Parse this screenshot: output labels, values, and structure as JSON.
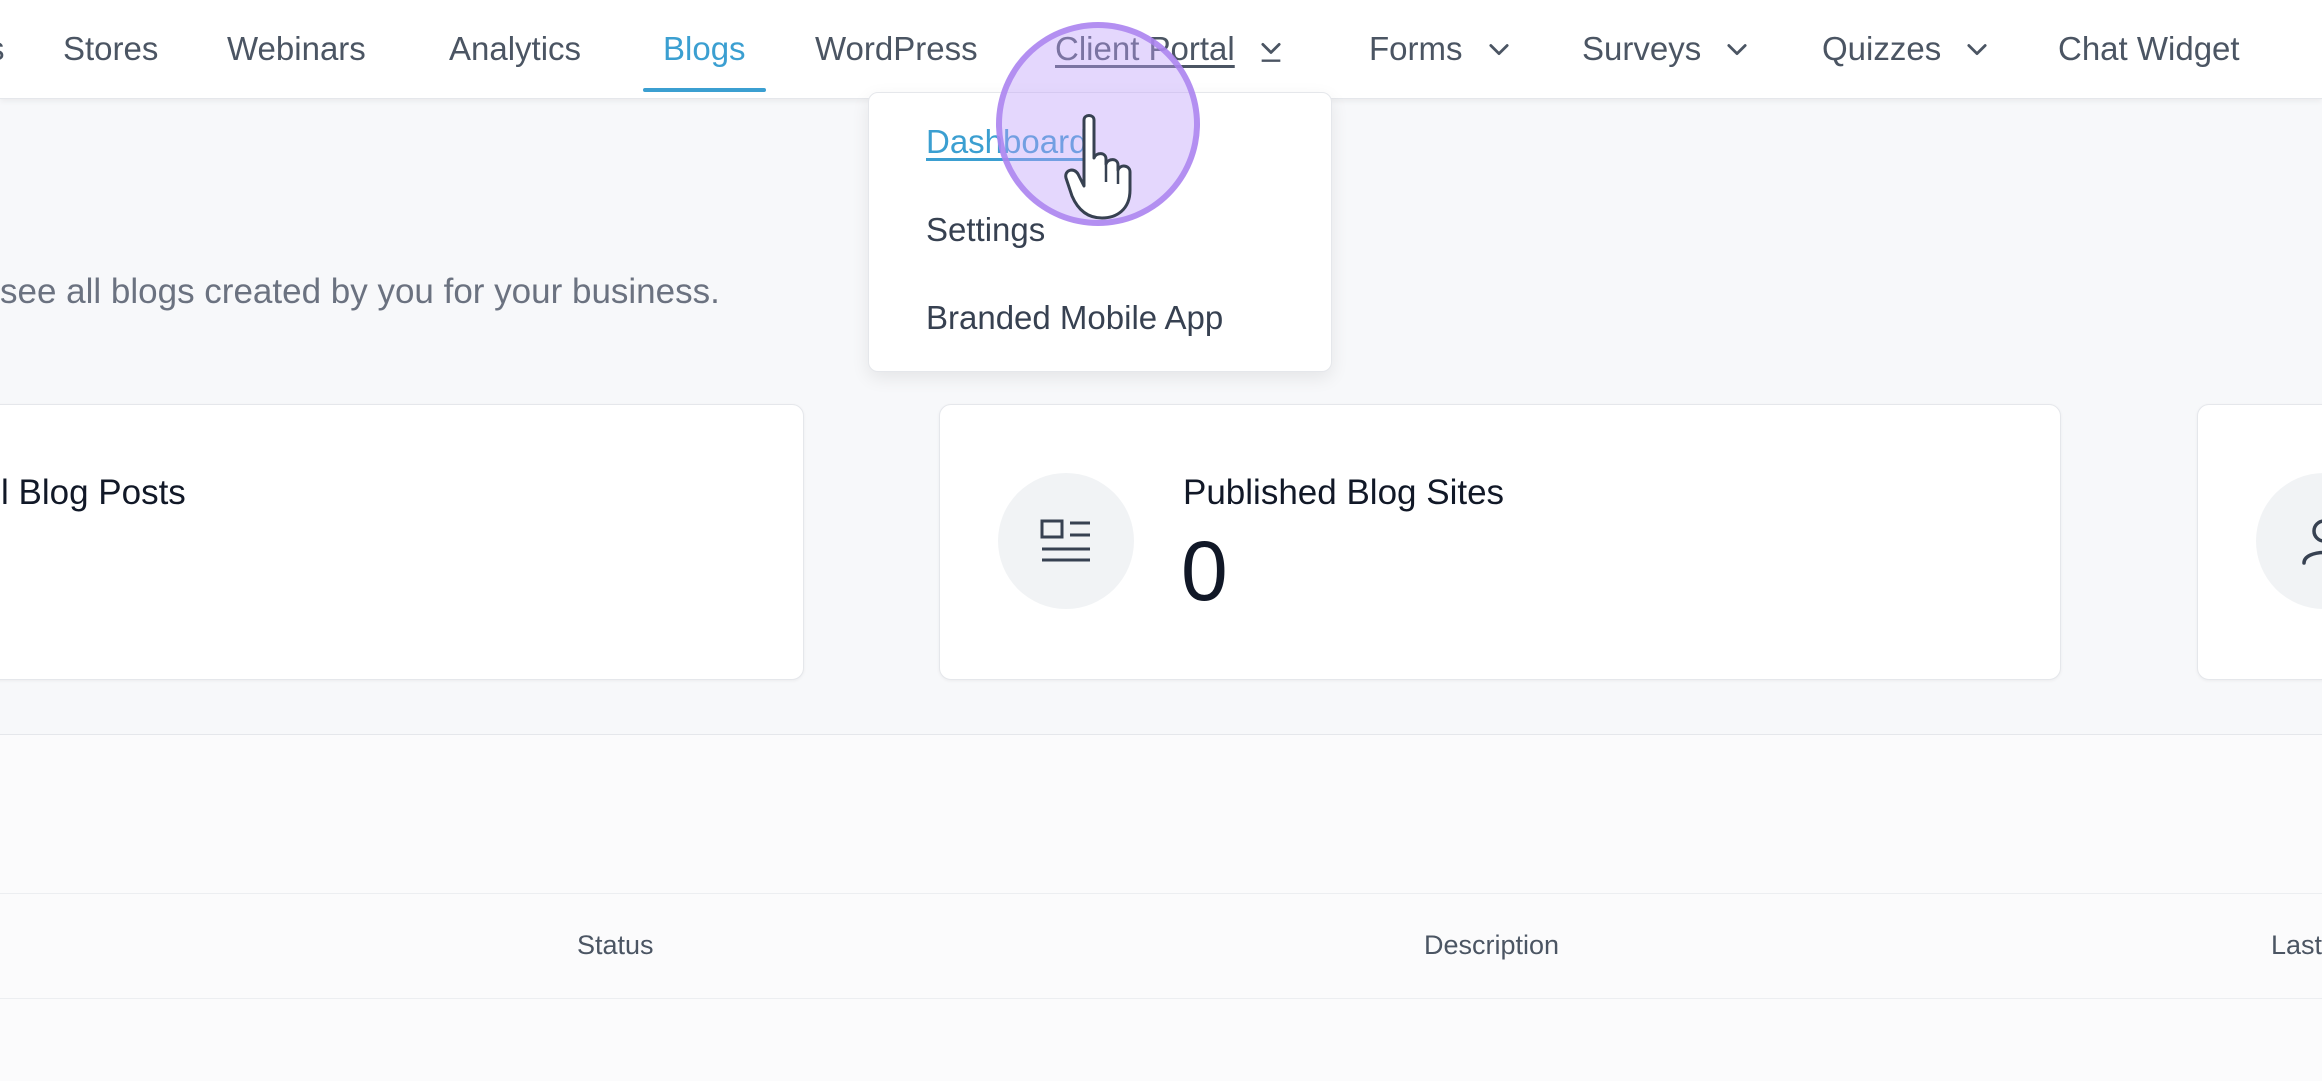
{
  "nav": {
    "items": [
      {
        "label": "s"
      },
      {
        "label": "Stores"
      },
      {
        "label": "Webinars"
      },
      {
        "label": "Analytics"
      },
      {
        "label": "Blogs"
      },
      {
        "label": "WordPress"
      },
      {
        "label": "Client Portal"
      },
      {
        "label": "Forms"
      },
      {
        "label": "Surveys"
      },
      {
        "label": "Quizzes"
      },
      {
        "label": "Chat Widget"
      }
    ],
    "active": "Blogs"
  },
  "dropdown": {
    "items": [
      {
        "label": "Dashboard"
      },
      {
        "label": "Settings"
      },
      {
        "label": "Branded Mobile App"
      }
    ]
  },
  "page": {
    "subtitle": "see all blogs created by you for your business."
  },
  "cards": [
    {
      "title": "l Blog Posts"
    },
    {
      "title": "Published Blog Sites",
      "value": "0"
    }
  ],
  "table": {
    "headers": {
      "status": "Status",
      "description": "Description",
      "last": "Last"
    }
  },
  "colors": {
    "accent": "#3b9fd1",
    "cursor_highlight": "#b79cf5"
  },
  "icons": [
    "chevron-down-icon",
    "blog-site-icon",
    "user-icon",
    "pointer-hand-icon"
  ]
}
